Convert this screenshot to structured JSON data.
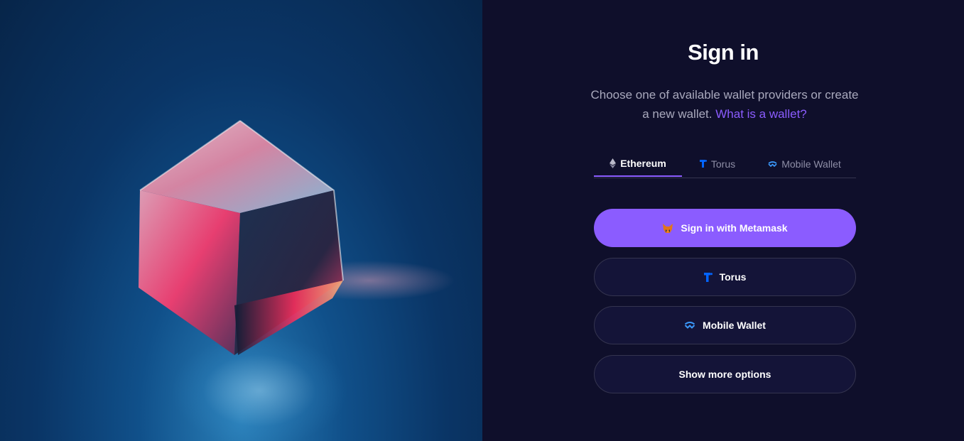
{
  "hero": {
    "image_alt": "Glowing glass cube"
  },
  "signin": {
    "title": "Sign in",
    "subtitle_text": "Choose one of available wallet providers or create a new wallet.",
    "subtitle_link": "What is a wallet?"
  },
  "tabs": [
    {
      "label": "Ethereum",
      "icon": "ethereum-icon",
      "active": true
    },
    {
      "label": "Torus",
      "icon": "torus-icon",
      "active": false
    },
    {
      "label": "Mobile Wallet",
      "icon": "walletconnect-icon",
      "active": false
    }
  ],
  "buttons": {
    "metamask": {
      "label": "Sign in with Metamask",
      "icon": "metamask-fox-icon"
    },
    "torus": {
      "label": "Torus",
      "icon": "torus-icon"
    },
    "mobile": {
      "label": "Mobile Wallet",
      "icon": "walletconnect-icon"
    },
    "more": {
      "label": "Show more options"
    }
  },
  "colors": {
    "accent": "#8b5cff",
    "background": "#0f0f2b",
    "button_background": "#141438",
    "border": "#34344f",
    "muted_text": "#a9a9bd",
    "torus_blue": "#0364ff",
    "walletconnect_blue": "#3b99fc"
  }
}
